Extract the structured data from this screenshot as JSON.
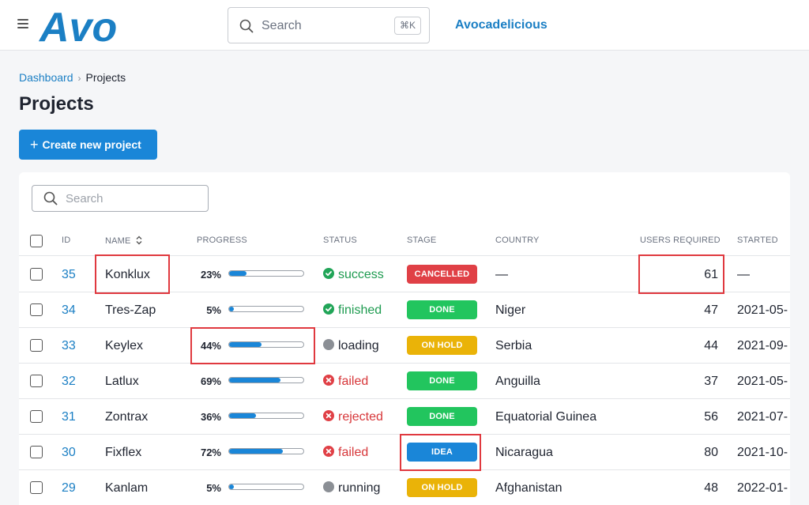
{
  "header": {
    "app_name": "Avocadelicious",
    "search": {
      "placeholder": "Search",
      "shortcut": "⌘K"
    },
    "logo_text": "Avo",
    "logo_color": "#1b7fc4"
  },
  "breadcrumb": {
    "parent": "Dashboard",
    "current": "Projects"
  },
  "page_title": "Projects",
  "create_button": {
    "label": "Create new project"
  },
  "table_search": {
    "placeholder": "Search"
  },
  "columns": {
    "id": "ID",
    "name": "NAME",
    "progress": "PROGRESS",
    "status": "STATUS",
    "stage": "STAGE",
    "country": "COUNTRY",
    "users_required": "USERS REQUIRED",
    "started": "STARTED"
  },
  "rows": [
    {
      "id": "35",
      "name": "Konklux",
      "progress": "23%",
      "progress_value": 0.23,
      "status": "success",
      "status_kind": "ok",
      "stage": "CANCELLED",
      "stage_color": "#e04046",
      "country": "—",
      "users": "61",
      "started": "—"
    },
    {
      "id": "34",
      "name": "Tres-Zap",
      "progress": "5%",
      "progress_value": 0.05,
      "status": "finished",
      "status_kind": "ok",
      "stage": "DONE",
      "stage_color": "#22c55e",
      "country": "Niger",
      "users": "47",
      "started": "2021-05-"
    },
    {
      "id": "33",
      "name": "Keylex",
      "progress": "44%",
      "progress_value": 0.44,
      "status": "loading",
      "status_kind": "neutral",
      "stage": "ON HOLD",
      "stage_color": "#eab308",
      "country": "Serbia",
      "users": "44",
      "started": "2021-09-"
    },
    {
      "id": "32",
      "name": "Latlux",
      "progress": "69%",
      "progress_value": 0.69,
      "status": "failed",
      "status_kind": "bad",
      "stage": "DONE",
      "stage_color": "#22c55e",
      "country": "Anguilla",
      "users": "37",
      "started": "2021-05-"
    },
    {
      "id": "31",
      "name": "Zontrax",
      "progress": "36%",
      "progress_value": 0.36,
      "status": "rejected",
      "status_kind": "bad",
      "stage": "DONE",
      "stage_color": "#22c55e",
      "country": "Equatorial Guinea",
      "users": "56",
      "started": "2021-07-"
    },
    {
      "id": "30",
      "name": "Fixflex",
      "progress": "72%",
      "progress_value": 0.72,
      "status": "failed",
      "status_kind": "bad",
      "stage": "IDEA",
      "stage_color": "#1a86d8",
      "country": "Nicaragua",
      "users": "80",
      "started": "2021-10-"
    },
    {
      "id": "29",
      "name": "Kanlam",
      "progress": "5%",
      "progress_value": 0.05,
      "status": "running",
      "status_kind": "neutral",
      "stage": "ON HOLD",
      "stage_color": "#eab308",
      "country": "Afghanistan",
      "users": "48",
      "started": "2022-01-"
    }
  ],
  "highlight_color": "#e0393f"
}
